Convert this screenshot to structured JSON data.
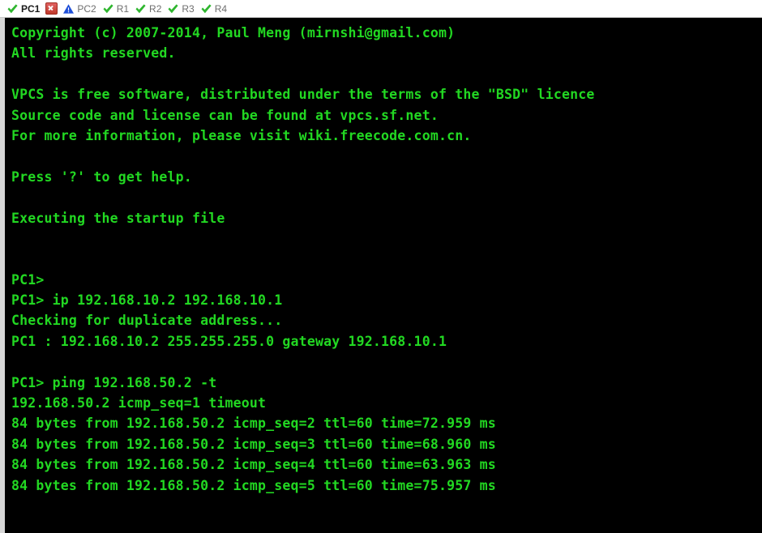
{
  "tabbar": {
    "tabs": [
      {
        "label": "PC1",
        "icon": "check-icon",
        "active": true,
        "has_close": true
      },
      {
        "label": "PC2",
        "icon": "warning-triangle-icon",
        "active": false,
        "has_close": false
      },
      {
        "label": "R1",
        "icon": "check-icon",
        "active": false,
        "has_close": false
      },
      {
        "label": "R2",
        "icon": "check-icon",
        "active": false,
        "has_close": false
      },
      {
        "label": "R3",
        "icon": "check-icon",
        "active": false,
        "has_close": false
      },
      {
        "label": "R4",
        "icon": "check-icon",
        "active": false,
        "has_close": false
      }
    ],
    "close_icon": "close-icon"
  },
  "colors": {
    "terminal_background": "#000000",
    "terminal_text": "#22d822",
    "tab_active_text": "#1a1a1a",
    "tab_inactive_text": "#6e6e6e",
    "check_green": "#2fb62f",
    "close_red": "#c0392b",
    "warning_blue": "#1f4fd8",
    "frame_gray": "#d7d7d7"
  },
  "terminal": {
    "lines": [
      "Copyright (c) 2007-2014, Paul Meng (mirnshi@gmail.com)",
      "All rights reserved.",
      "",
      "VPCS is free software, distributed under the terms of the \"BSD\" licence",
      "Source code and license can be found at vpcs.sf.net.",
      "For more information, please visit wiki.freecode.com.cn.",
      "",
      "Press '?' to get help.",
      "",
      "Executing the startup file",
      "",
      "",
      "PC1>",
      "PC1> ip 192.168.10.2 192.168.10.1",
      "Checking for duplicate address...",
      "PC1 : 192.168.10.2 255.255.255.0 gateway 192.168.10.1",
      "",
      "PC1> ping 192.168.50.2 -t",
      "192.168.50.2 icmp_seq=1 timeout",
      "84 bytes from 192.168.50.2 icmp_seq=2 ttl=60 time=72.959 ms",
      "84 bytes from 192.168.50.2 icmp_seq=3 ttl=60 time=68.960 ms",
      "84 bytes from 192.168.50.2 icmp_seq=4 ttl=60 time=63.963 ms",
      "84 bytes from 192.168.50.2 icmp_seq=5 ttl=60 time=75.957 ms"
    ]
  }
}
